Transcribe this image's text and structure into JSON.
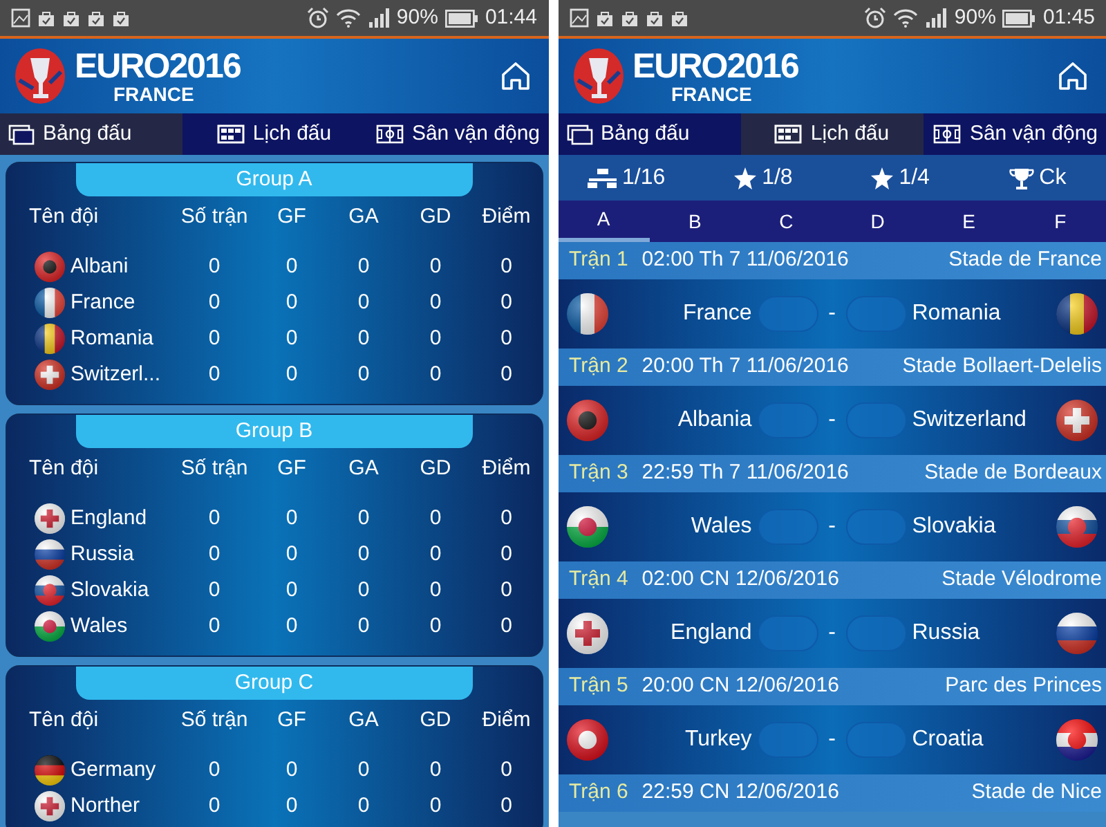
{
  "screens": [
    {
      "kind": "standings",
      "status_bar": {
        "battery": "90%",
        "time": "01:44"
      },
      "header": {
        "title": "EURO2016",
        "subtitle": "FRANCE"
      },
      "tabs": [
        {
          "label": "Bảng đấu",
          "selected": true
        },
        {
          "label": "Lịch đấu",
          "selected": false
        },
        {
          "label": "Sân vận động",
          "selected": false
        }
      ],
      "groups": [
        {
          "title": "Group A",
          "columns": [
            "Tên đội",
            "Số trận",
            "GF",
            "GA",
            "GD",
            "Điểm"
          ],
          "teams": [
            {
              "name": "Albani",
              "stats": [
                "0",
                "0",
                "0",
                "0",
                "0"
              ]
            },
            {
              "name": "France",
              "stats": [
                "0",
                "0",
                "0",
                "0",
                "0"
              ]
            },
            {
              "name": "Romania",
              "stats": [
                "0",
                "0",
                "0",
                "0",
                "0"
              ]
            },
            {
              "name": "Switzerl...",
              "stats": [
                "0",
                "0",
                "0",
                "0",
                "0"
              ]
            }
          ]
        },
        {
          "title": "Group B",
          "columns": [
            "Tên đội",
            "Số trận",
            "GF",
            "GA",
            "GD",
            "Điểm"
          ],
          "teams": [
            {
              "name": "England",
              "stats": [
                "0",
                "0",
                "0",
                "0",
                "0"
              ]
            },
            {
              "name": "Russia",
              "stats": [
                "0",
                "0",
                "0",
                "0",
                "0"
              ]
            },
            {
              "name": "Slovakia",
              "stats": [
                "0",
                "0",
                "0",
                "0",
                "0"
              ]
            },
            {
              "name": "Wales",
              "stats": [
                "0",
                "0",
                "0",
                "0",
                "0"
              ]
            }
          ]
        },
        {
          "title": "Group C",
          "columns": [
            "Tên đội",
            "Số trận",
            "GF",
            "GA",
            "GD",
            "Điểm"
          ],
          "teams": [
            {
              "name": "Germany",
              "stats": [
                "0",
                "0",
                "0",
                "0",
                "0"
              ]
            },
            {
              "name": "Norther",
              "stats": [
                "0",
                "0",
                "0",
                "0",
                "0"
              ]
            }
          ]
        }
      ]
    },
    {
      "kind": "schedule",
      "status_bar": {
        "battery": "90%",
        "time": "01:45"
      },
      "header": {
        "title": "EURO2016",
        "subtitle": "FRANCE"
      },
      "tabs": [
        {
          "label": "Bảng đấu",
          "selected": false
        },
        {
          "label": "Lịch đấu",
          "selected": true
        },
        {
          "label": "Sân vận động",
          "selected": false
        }
      ],
      "rounds": [
        {
          "label": "1/16"
        },
        {
          "label": "1/8"
        },
        {
          "label": "1/4"
        },
        {
          "label": "Ck"
        }
      ],
      "group_tabs": [
        {
          "label": "A",
          "selected": true
        },
        {
          "label": "B",
          "selected": false
        },
        {
          "label": "C",
          "selected": false
        },
        {
          "label": "D",
          "selected": false
        },
        {
          "label": "E",
          "selected": false
        },
        {
          "label": "F",
          "selected": false
        }
      ],
      "matches": [
        {
          "number": "Trận 1",
          "datetime": "02:00 Th 7 11/06/2016",
          "venue": "Stade de France",
          "separator": "-",
          "home": "France",
          "away": "Romania"
        },
        {
          "number": "Trận 2",
          "datetime": "20:00 Th 7 11/06/2016",
          "venue": "Stade Bollaert-Delelis",
          "separator": "-",
          "home": "Albania",
          "away": "Switzerland"
        },
        {
          "number": "Trận 3",
          "datetime": "22:59 Th 7 11/06/2016",
          "venue": "Stade de Bordeaux",
          "separator": "-",
          "home": "Wales",
          "away": "Slovakia"
        },
        {
          "number": "Trận 4",
          "datetime": "02:00 CN 12/06/2016",
          "venue": "Stade Vélodrome",
          "separator": "-",
          "home": "England",
          "away": "Russia"
        },
        {
          "number": "Trận 5",
          "datetime": "20:00 CN 12/06/2016",
          "venue": "Parc des Princes",
          "separator": "-",
          "home": "Turkey",
          "away": "Croatia"
        },
        {
          "number": "Trận 6",
          "datetime": "22:59 CN 12/06/2016",
          "venue": "Stade de Nice"
        }
      ]
    }
  ]
}
